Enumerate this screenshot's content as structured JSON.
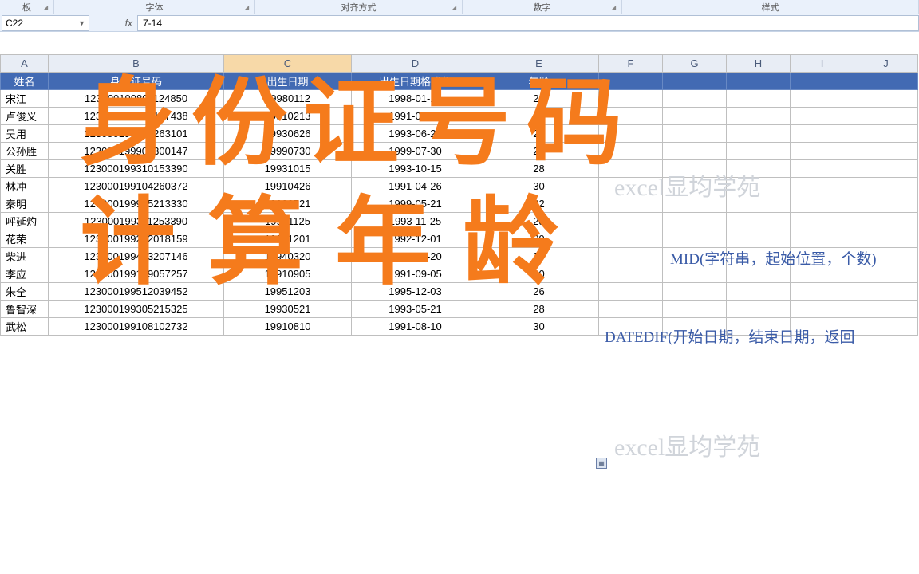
{
  "ribbon": {
    "group0": "板",
    "group1": "字体",
    "group2": "对齐方式",
    "group3": "数字",
    "group4": "样式"
  },
  "namebox": {
    "cell": "C22"
  },
  "formula": {
    "value": "7-14"
  },
  "columns": [
    "A",
    "B",
    "C",
    "D",
    "E",
    "F",
    "G",
    "H",
    "I",
    "J"
  ],
  "headers": {
    "name": "姓名",
    "id": "身份证号码",
    "birth": "出生日期",
    "birthFmt": "出生日期格式化",
    "age": "年龄"
  },
  "rows": [
    {
      "name": "宋江",
      "id": "123000199801124850",
      "birth": "19980112",
      "birthFmt": "1998-01-12",
      "age": "23"
    },
    {
      "name": "卢俊义",
      "id": "123000199102137438",
      "birth": "19910213",
      "birthFmt": "1991-02-13",
      "age": "30"
    },
    {
      "name": "吴用",
      "id": "123000199306263101",
      "birth": "19930626",
      "birthFmt": "1993-06-26",
      "age": "28"
    },
    {
      "name": "公孙胜",
      "id": "123000199907300147",
      "birth": "19990730",
      "birthFmt": "1999-07-30",
      "age": "22"
    },
    {
      "name": "关胜",
      "id": "123000199310153390",
      "birth": "19931015",
      "birthFmt": "1993-10-15",
      "age": "28"
    },
    {
      "name": "林冲",
      "id": "123000199104260372",
      "birth": "19910426",
      "birthFmt": "1991-04-26",
      "age": "30"
    },
    {
      "name": "秦明",
      "id": "123000199905213330",
      "birth": "19990521",
      "birthFmt": "1999-05-21",
      "age": "22"
    },
    {
      "name": "呼延灼",
      "id": "123000199311253390",
      "birth": "19931125",
      "birthFmt": "1993-11-25",
      "age": "28"
    },
    {
      "name": "花荣",
      "id": "123000199212018159",
      "birth": "19921201",
      "birthFmt": "1992-12-01",
      "age": "29"
    },
    {
      "name": "柴进",
      "id": "123000199403207146",
      "birth": "19940320",
      "birthFmt": "1994-03-20",
      "age": "27"
    },
    {
      "name": "李应",
      "id": "123000199109057257",
      "birth": "19910905",
      "birthFmt": "1991-09-05",
      "age": "30"
    },
    {
      "name": "朱仝",
      "id": "123000199512039452",
      "birth": "19951203",
      "birthFmt": "1995-12-03",
      "age": "26"
    },
    {
      "name": "鲁智深",
      "id": "123000199305215325",
      "birth": "19930521",
      "birthFmt": "1993-05-21",
      "age": "28"
    },
    {
      "name": "武松",
      "id": "123000199108102732",
      "birth": "19910810",
      "birthFmt": "1991-08-10",
      "age": "30"
    }
  ],
  "overlay": {
    "line1": "身份证号码",
    "line2": "计算年龄"
  },
  "watermark": "excel显均学苑",
  "hints": {
    "mid": "MID(字符串，起始位置，个数)",
    "datedif": "DATEDIF(开始日期，结束日期，返回"
  }
}
